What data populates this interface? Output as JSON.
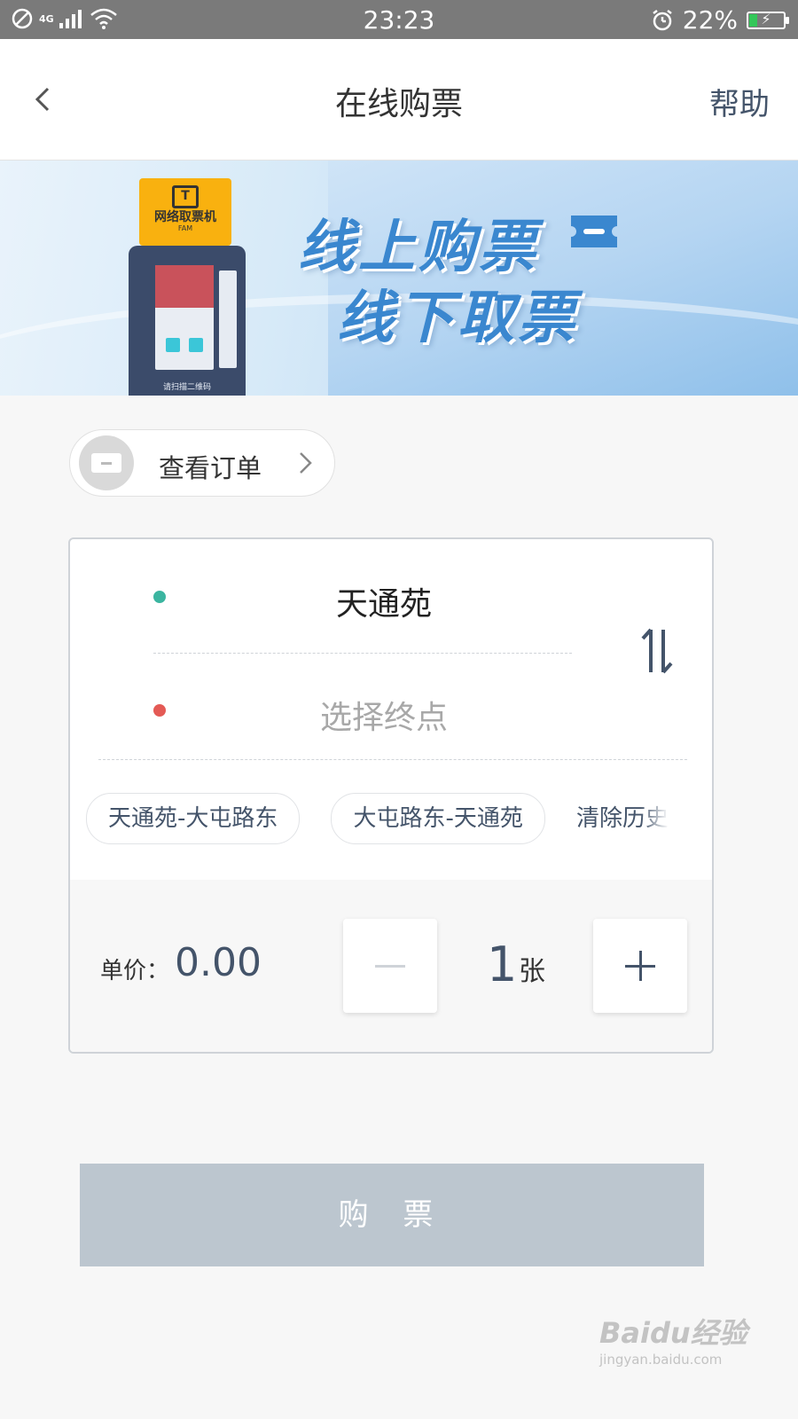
{
  "status_bar": {
    "network": "4G",
    "time": "23:23",
    "battery": "22%",
    "battery_level": 0.22
  },
  "nav": {
    "title": "在线购票",
    "help": "帮助"
  },
  "banner": {
    "kiosk_label": "网络取票机",
    "kiosk_sub": "FAM",
    "kiosk_caption": "请扫描二维码",
    "line1": "线上购票",
    "line2": "线下取票"
  },
  "order": {
    "label": "查看订单"
  },
  "trip": {
    "from": "天通苑",
    "to_placeholder": "选择终点"
  },
  "history": {
    "items": [
      "天通苑-大屯路东",
      "大屯路东-天通苑"
    ],
    "clear": "清除历史"
  },
  "price": {
    "label": "单价：",
    "value": "0.00"
  },
  "quantity": {
    "value": "1",
    "unit": "张"
  },
  "buy_button": "购 票",
  "watermark": {
    "logo": "Baidu经验",
    "url": "jingyan.baidu.com"
  },
  "colors": {
    "accent": "#44546a",
    "start_dot": "#3bb5a0",
    "end_dot": "#e45a55",
    "buy_disabled": "#bcc6cf"
  }
}
